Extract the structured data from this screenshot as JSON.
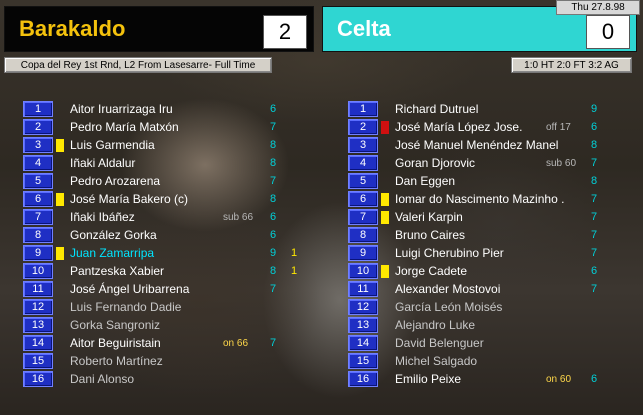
{
  "header": {
    "home_team": "Barakaldo",
    "home_score": "2",
    "away_team": "Celta",
    "away_score": "0",
    "date": "Thu 27.8.98",
    "competition": "Copa del Rey 1st Rnd, L2 From Lasesarre- Full Time",
    "result": "1:0 HT 2:0 FT 3:2 AG"
  },
  "colors": {
    "home_team_text": "#f4c20d",
    "home_team_bg": "#050505",
    "away_team_text": "#ffffff",
    "away_team_bg": "#2fd6d2",
    "shirt_number_bg": "#1f2fc4",
    "yellow_card": "#ffe800",
    "red_card": "#d01010",
    "rating_text": "#00d0d8"
  },
  "home_players": [
    {
      "num": "1",
      "name": "Aitor Iruarrizaga Iru",
      "rating": "6",
      "card": "",
      "note": "",
      "goals": "",
      "style": ""
    },
    {
      "num": "2",
      "name": "Pedro María Matxón",
      "rating": "7",
      "card": "",
      "note": "",
      "goals": "",
      "style": ""
    },
    {
      "num": "3",
      "name": "Luis Garmendia",
      "rating": "8",
      "card": "yellow",
      "note": "",
      "goals": "",
      "style": ""
    },
    {
      "num": "4",
      "name": "Iñaki Aldalur",
      "rating": "8",
      "card": "",
      "note": "",
      "goals": "",
      "style": ""
    },
    {
      "num": "5",
      "name": "Pedro Arozarena",
      "rating": "7",
      "card": "",
      "note": "",
      "goals": "",
      "style": ""
    },
    {
      "num": "6",
      "name": "José María Bakero (c)",
      "rating": "8",
      "card": "yellow",
      "note": "",
      "goals": "",
      "style": ""
    },
    {
      "num": "7",
      "name": "Iñaki Ibáñez",
      "rating": "6",
      "card": "",
      "note": "sub 66",
      "goals": "",
      "style": ""
    },
    {
      "num": "8",
      "name": "González Gorka",
      "rating": "6",
      "card": "",
      "note": "",
      "goals": "",
      "style": ""
    },
    {
      "num": "9",
      "name": "Juan Zamarripa",
      "rating": "9",
      "card": "yellow",
      "note": "",
      "goals": "1",
      "style": "hl"
    },
    {
      "num": "10",
      "name": "Pantzeska Xabier",
      "rating": "8",
      "card": "",
      "note": "",
      "goals": "1",
      "style": ""
    },
    {
      "num": "11",
      "name": "José Ángel Uribarrena",
      "rating": "7",
      "card": "",
      "note": "",
      "goals": "",
      "style": ""
    },
    {
      "num": "12",
      "name": "Luis Fernando Dadie",
      "rating": "",
      "card": "",
      "note": "",
      "goals": "",
      "style": "sub"
    },
    {
      "num": "13",
      "name": "Gorka Sangroniz",
      "rating": "",
      "card": "",
      "note": "",
      "goals": "",
      "style": "sub"
    },
    {
      "num": "14",
      "name": "Aitor Beguiristain",
      "rating": "7",
      "card": "",
      "note": "on 66",
      "goals": "",
      "style": ""
    },
    {
      "num": "15",
      "name": "Roberto Martínez",
      "rating": "",
      "card": "",
      "note": "",
      "goals": "",
      "style": "sub"
    },
    {
      "num": "16",
      "name": "Dani Alonso",
      "rating": "",
      "card": "",
      "note": "",
      "goals": "",
      "style": "sub"
    }
  ],
  "away_players": [
    {
      "num": "1",
      "name": "Richard Dutruel",
      "rating": "9",
      "card": "",
      "note": "",
      "style": ""
    },
    {
      "num": "2",
      "name": "José María López Jose.",
      "rating": "6",
      "card": "red",
      "note": "off 17",
      "style": ""
    },
    {
      "num": "3",
      "name": "José Manuel Menéndez Manel",
      "rating": "8",
      "card": "",
      "note": "",
      "style": ""
    },
    {
      "num": "4",
      "name": "Goran Djorovic",
      "rating": "7",
      "card": "",
      "note": "sub 60",
      "style": ""
    },
    {
      "num": "5",
      "name": "Dan Eggen",
      "rating": "8",
      "card": "",
      "note": "",
      "style": ""
    },
    {
      "num": "6",
      "name": "Iomar do Nascimento Mazinho .",
      "rating": "7",
      "card": "yellow",
      "note": "",
      "style": ""
    },
    {
      "num": "7",
      "name": "Valeri Karpin",
      "rating": "7",
      "card": "yellow",
      "note": "",
      "style": ""
    },
    {
      "num": "8",
      "name": "Bruno Caires",
      "rating": "7",
      "card": "",
      "note": "",
      "style": ""
    },
    {
      "num": "9",
      "name": "Luigi Cherubino Pier",
      "rating": "7",
      "card": "",
      "note": "",
      "style": ""
    },
    {
      "num": "10",
      "name": "Jorge Cadete",
      "rating": "6",
      "card": "yellow",
      "note": "",
      "style": ""
    },
    {
      "num": "11",
      "name": "Alexander Mostovoi",
      "rating": "7",
      "card": "",
      "note": "",
      "style": ""
    },
    {
      "num": "12",
      "name": "García León Moisés",
      "rating": "",
      "card": "",
      "note": "",
      "style": "sub"
    },
    {
      "num": "13",
      "name": "Alejandro Luke",
      "rating": "",
      "card": "",
      "note": "",
      "style": "sub"
    },
    {
      "num": "14",
      "name": "David Belenguer",
      "rating": "",
      "card": "",
      "note": "",
      "style": "sub"
    },
    {
      "num": "15",
      "name": "Michel Salgado",
      "rating": "",
      "card": "",
      "note": "",
      "style": "sub"
    },
    {
      "num": "16",
      "name": "Emilio Peixe",
      "rating": "6",
      "card": "",
      "note": "on 60",
      "style": ""
    }
  ]
}
